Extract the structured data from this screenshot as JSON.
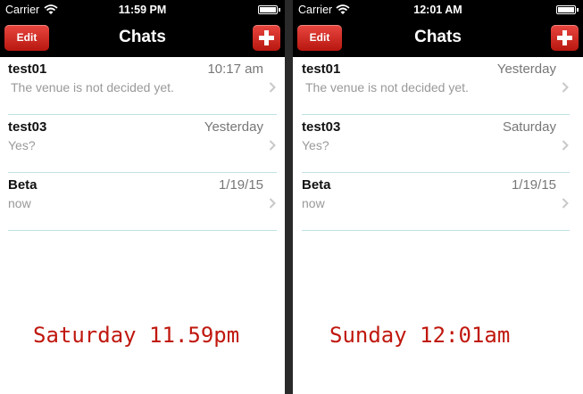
{
  "screens": [
    {
      "status": {
        "carrier": "Carrier",
        "time": "11:59 PM"
      },
      "nav": {
        "title": "Chats",
        "edit_label": "Edit"
      },
      "chats": [
        {
          "name": "test01",
          "time": "10:17 am",
          "preview": "The venue is not decided yet."
        },
        {
          "name": "test03",
          "time": "Yesterday",
          "preview": "Yes?"
        },
        {
          "name": "Beta",
          "time": "1/19/15",
          "preview": "now"
        }
      ],
      "caption": "Saturday 11.59pm"
    },
    {
      "status": {
        "carrier": "Carrier",
        "time": "12:01 AM"
      },
      "nav": {
        "title": "Chats",
        "edit_label": "Edit"
      },
      "chats": [
        {
          "name": "test01",
          "time": "Yesterday",
          "preview": "The venue is not decided yet."
        },
        {
          "name": "test03",
          "time": "Saturday",
          "preview": "Yes?"
        },
        {
          "name": "Beta",
          "time": "1/19/15",
          "preview": "now"
        }
      ],
      "caption": "Sunday 12:01am"
    }
  ],
  "colors": {
    "navbar": "#000000",
    "button": "#d0261f",
    "caption": "#c0180e",
    "separator": "#bfe2e6"
  },
  "icons": {
    "wifi": "wifi-icon",
    "battery": "battery-icon",
    "add": "plus-icon",
    "chevron": "chevron-right-icon"
  }
}
